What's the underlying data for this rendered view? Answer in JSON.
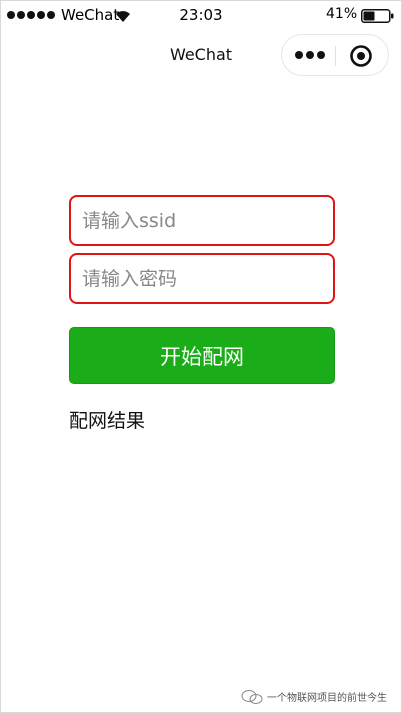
{
  "status_bar": {
    "carrier": "WeChat",
    "time": "23:03",
    "battery": "41%"
  },
  "nav": {
    "title": "WeChat",
    "more_icon": "more-dots-icon",
    "close_icon": "target-circle-icon"
  },
  "form": {
    "ssid_placeholder": "请输入ssid",
    "password_placeholder": "请输入密码",
    "start_button": "开始配网",
    "result_label": "配网结果"
  },
  "watermark": {
    "text": "一个物联网项目的前世今生"
  },
  "colors": {
    "primary_button": "#1aad19",
    "input_border": "#e01414"
  }
}
